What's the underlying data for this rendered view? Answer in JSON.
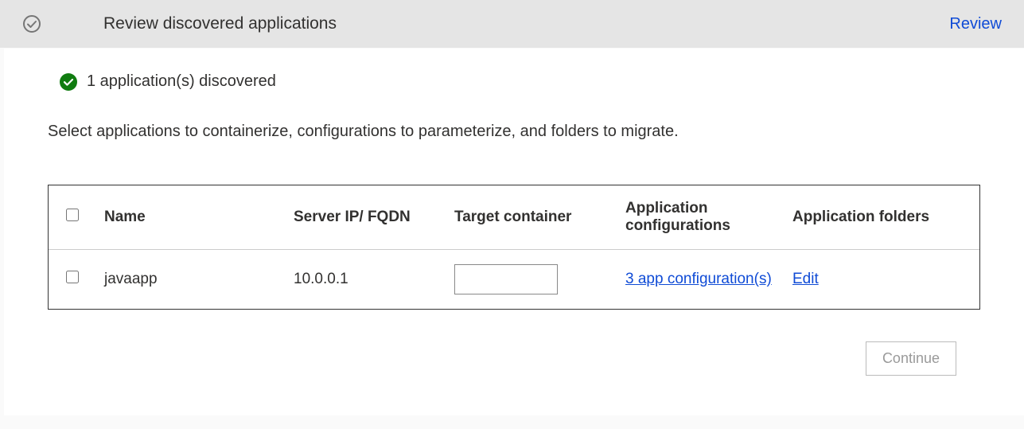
{
  "header": {
    "title": "Review discovered applications",
    "review_link": "Review"
  },
  "status": {
    "text": "1 application(s) discovered"
  },
  "description": "Select applications to containerize, configurations to parameterize, and folders to migrate.",
  "table": {
    "columns": {
      "name": "Name",
      "server": "Server IP/ FQDN",
      "target": "Target container",
      "config": "Application configurations",
      "folders": "Application folders"
    },
    "rows": [
      {
        "name": "javaapp",
        "server": "10.0.0.1",
        "target": "",
        "config_link": "3 app configuration(s)",
        "folder_link": "Edit"
      }
    ]
  },
  "footer": {
    "continue": "Continue"
  }
}
